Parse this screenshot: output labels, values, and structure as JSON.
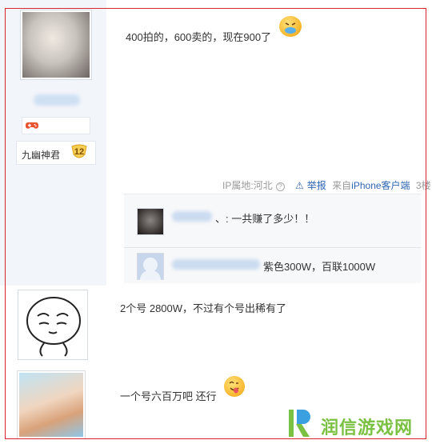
{
  "posts": [
    {
      "text": "400拍的，600卖的，现在900了",
      "emoji": "sick-face-emoji",
      "meta": {
        "ip_location": "IP属地:河北",
        "report_label": "举报",
        "source_prefix": "来自",
        "source_device": "iPhone客户端",
        "floor": "3楼"
      },
      "replies": [
        {
          "text": "、: 一共赚了多少！！"
        },
        {
          "text": "紫色300W，百联1000W"
        }
      ]
    },
    {
      "text": "2个号 2800W，不过有个号出稀有了"
    },
    {
      "text": "一个号六百万吧 还行",
      "emoji": "tongue-out-emoji"
    }
  ],
  "user": {
    "level_name": "九幽神君",
    "level_number": "12",
    "badge_icon": "gamepad-icon"
  },
  "watermark": {
    "text": "润信游戏网",
    "color": "#7ac143"
  },
  "colors": {
    "frame": "#d9232d",
    "link": "#2d64b3",
    "sidebar": "#f2f5fa"
  }
}
